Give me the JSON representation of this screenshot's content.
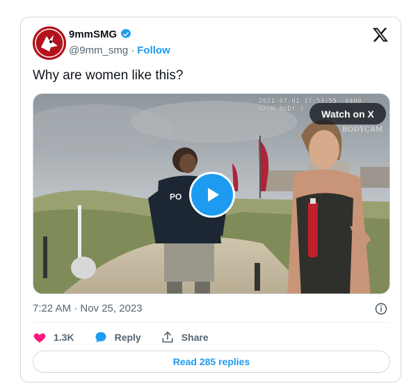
{
  "author": {
    "name": "9mmSMG",
    "handle": "@9mm_smg",
    "separator": "·",
    "follow_label": "Follow"
  },
  "tweet": {
    "text": "Why are women like this?",
    "timestamp": "7:22 AM · Nov 25, 2023"
  },
  "media": {
    "watch_label": "Watch on X",
    "cam_line1": "2021-07-01 17:53:55 -0400",
    "cam_line2": "AXON BODY 3",
    "cam_label": "BODYCAM",
    "vest_text": "PO"
  },
  "actions": {
    "likes": "1.3K",
    "reply_label": "Reply",
    "share_label": "Share"
  },
  "replies_button": "Read 285 replies",
  "colors": {
    "accent": "#1d9bf0",
    "like": "#f91880",
    "text": "#0f1419",
    "muted": "#536471",
    "border": "#cfd9de"
  }
}
